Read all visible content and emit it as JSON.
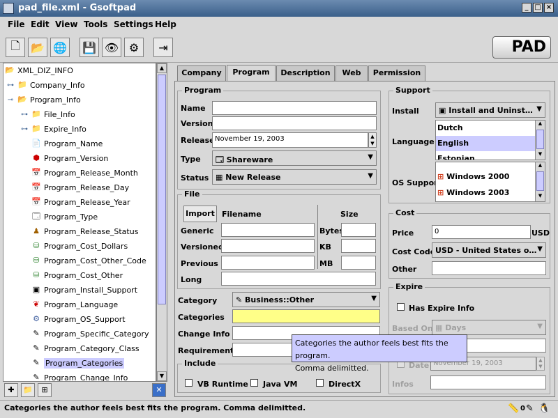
{
  "window": {
    "title": "pad_file.xml - Gsoftpad",
    "controls": {
      "minimize": "_",
      "maximize": "□",
      "close": "×"
    }
  },
  "menu": [
    "File",
    "Edit",
    "View",
    "Tools",
    "Settings",
    "Help"
  ],
  "toolbar": {
    "buttons": [
      "new-file-icon",
      "open-folder-icon",
      "open-web-icon",
      "save-icon",
      "eye-icon",
      "network-icon",
      "exit-icon"
    ],
    "logo": "PAD"
  },
  "tree": {
    "root": "XML_DIZ_INFO",
    "items": [
      {
        "label": "Company_Info"
      },
      {
        "label": "Program_Info"
      },
      {
        "label": "File_Info"
      },
      {
        "label": "Expire_Info"
      },
      {
        "label": "Program_Name"
      },
      {
        "label": "Program_Version"
      },
      {
        "label": "Program_Release_Month"
      },
      {
        "label": "Program_Release_Day"
      },
      {
        "label": "Program_Release_Year"
      },
      {
        "label": "Program_Type"
      },
      {
        "label": "Program_Release_Status"
      },
      {
        "label": "Program_Cost_Dollars"
      },
      {
        "label": "Program_Cost_Other_Code"
      },
      {
        "label": "Program_Cost_Other"
      },
      {
        "label": "Program_Install_Support"
      },
      {
        "label": "Program_Language"
      },
      {
        "label": "Program_OS_Support"
      },
      {
        "label": "Program_Specific_Category"
      },
      {
        "label": "Program_Category_Class"
      },
      {
        "label": "Program_Categories"
      },
      {
        "label": "Program_Change_Info"
      }
    ],
    "selected": "Program_Categories"
  },
  "tabs": [
    "Company",
    "Program",
    "Description",
    "Web",
    "Permission"
  ],
  "active_tab": "Program",
  "program": {
    "group_title": "Program",
    "name_label": "Name",
    "name_value": "",
    "version_label": "Version",
    "version_value": "",
    "release_label": "Release",
    "release_value": "November 19, 2003",
    "type_label": "Type",
    "type_value": "Shareware",
    "status_label": "Status",
    "status_value": "New Release"
  },
  "file": {
    "group_title": "File",
    "import_button": "Import",
    "filename_header": "Filename",
    "size_header": "Size",
    "generic_label": "Generic",
    "versioned_label": "Versioned",
    "previous_label": "Previous",
    "long_label": "Long",
    "bytes_label": "Bytes",
    "kb_label": "KB",
    "mb_label": "MB"
  },
  "category": {
    "category_label": "Category",
    "category_value": "Business::Other",
    "categories_label": "Categories",
    "change_info_label": "Change Info",
    "requirements_label": "Requirements"
  },
  "include": {
    "group_title": "Include",
    "options": [
      "VB Runtime",
      "Java VM",
      "DirectX"
    ]
  },
  "support": {
    "group_title": "Support",
    "install_label": "Install",
    "install_value": "Install and Uninst…",
    "language_label": "Language",
    "languages": [
      "Dutch",
      "English",
      "Estonian"
    ],
    "selected_language": "English",
    "os_label": "OS Support",
    "os_list": [
      "Windows 2000",
      "Windows 2003"
    ]
  },
  "cost": {
    "group_title": "Cost",
    "price_label": "Price",
    "price_value": "0",
    "currency": "USD",
    "cost_code_label": "Cost Code",
    "cost_code_value": "USD - United States o…",
    "other_label": "Other"
  },
  "expire": {
    "group_title": "Expire",
    "has_expire_label": "Has Expire Info",
    "based_on_label": "Based On",
    "based_on_value": "Days",
    "date_label": "Date",
    "date_value": "November 19, 2003",
    "infos_label": "Infos"
  },
  "tooltip": {
    "line1": "Categories the author feels best fits the program.",
    "line2": "Comma delimitted."
  },
  "status": "Categories the author feels best fits the program. Comma delimitted."
}
